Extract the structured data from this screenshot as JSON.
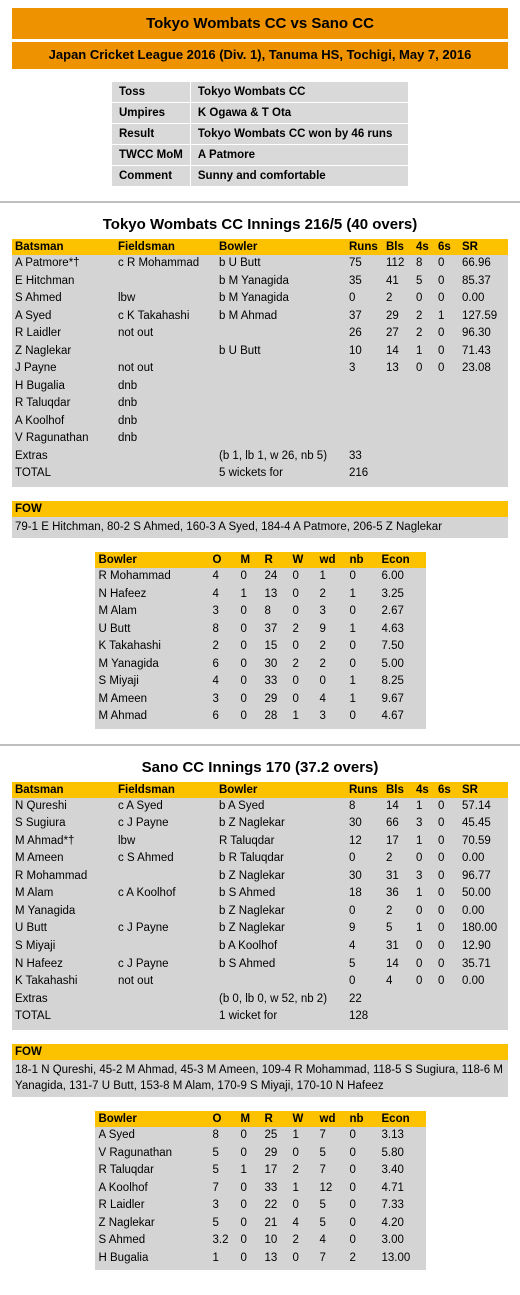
{
  "colors": {
    "title_orange": "#ee9200",
    "header_yellow": "#fcc200",
    "row_grey": "#d4d4d4",
    "info_grey": "#d9d9d9",
    "divider": "#bfbfbf"
  },
  "header": {
    "match_title": "Tokyo Wombats CC vs Sano CC",
    "match_subtitle": "Japan Cricket League 2016 (Div. 1), Tanuma HS, Tochigi, May 7, 2016"
  },
  "info": {
    "rows": [
      {
        "key": "Toss",
        "value": "Tokyo Wombats CC"
      },
      {
        "key": "Umpires",
        "value": "K Ogawa & T Ota"
      },
      {
        "key": "Result",
        "value": "Tokyo Wombats CC won by 46 runs"
      },
      {
        "key": "TWCC MoM",
        "value": "A Patmore"
      },
      {
        "key": "Comment",
        "value": "Sunny and comfortable"
      }
    ]
  },
  "batting_columns": [
    "Batsman",
    "Fieldsman",
    "Bowler",
    "Runs",
    "Bls",
    "4s",
    "6s",
    "SR"
  ],
  "bowling_columns": [
    "Bowler",
    "O",
    "M",
    "R",
    "W",
    "wd",
    "nb",
    "Econ"
  ],
  "fow_label": "FOW",
  "innings": [
    {
      "heading": "Tokyo Wombats CC Innings 216/5 (40 overs)",
      "batting": [
        {
          "batsman": "A Patmore*†",
          "fieldsman": "c R Mohammad",
          "bowler": "b U Butt",
          "runs": "75",
          "bls": "112",
          "fours": "8",
          "sixes": "0",
          "sr": "66.96"
        },
        {
          "batsman": "E Hitchman",
          "fieldsman": "",
          "bowler": "b M Yanagida",
          "runs": "35",
          "bls": "41",
          "fours": "5",
          "sixes": "0",
          "sr": "85.37"
        },
        {
          "batsman": "S Ahmed",
          "fieldsman": "lbw",
          "bowler": "b M Yanagida",
          "runs": "0",
          "bls": "2",
          "fours": "0",
          "sixes": "0",
          "sr": "0.00"
        },
        {
          "batsman": "A Syed",
          "fieldsman": "c K Takahashi",
          "bowler": "b M Ahmad",
          "runs": "37",
          "bls": "29",
          "fours": "2",
          "sixes": "1",
          "sr": "127.59"
        },
        {
          "batsman": "R Laidler",
          "fieldsman": "not out",
          "bowler": "",
          "runs": "26",
          "bls": "27",
          "fours": "2",
          "sixes": "0",
          "sr": "96.30"
        },
        {
          "batsman": "Z Naglekar",
          "fieldsman": "",
          "bowler": "b U Butt",
          "runs": "10",
          "bls": "14",
          "fours": "1",
          "sixes": "0",
          "sr": "71.43"
        },
        {
          "batsman": "J Payne",
          "fieldsman": "not out",
          "bowler": "",
          "runs": "3",
          "bls": "13",
          "fours": "0",
          "sixes": "0",
          "sr": "23.08"
        },
        {
          "batsman": "H Bugalia",
          "fieldsman": "dnb",
          "bowler": "",
          "runs": "",
          "bls": "",
          "fours": "",
          "sixes": "",
          "sr": ""
        },
        {
          "batsman": "R Taluqdar",
          "fieldsman": "dnb",
          "bowler": "",
          "runs": "",
          "bls": "",
          "fours": "",
          "sixes": "",
          "sr": ""
        },
        {
          "batsman": "A Koolhof",
          "fieldsman": "dnb",
          "bowler": "",
          "runs": "",
          "bls": "",
          "fours": "",
          "sixes": "",
          "sr": ""
        },
        {
          "batsman": "V Ragunathan",
          "fieldsman": "dnb",
          "bowler": "",
          "runs": "",
          "bls": "",
          "fours": "",
          "sixes": "",
          "sr": ""
        },
        {
          "batsman": "Extras",
          "fieldsman": "",
          "bowler": "(b 1, lb 1, w 26, nb 5)",
          "runs": "33",
          "bls": "",
          "fours": "",
          "sixes": "",
          "sr": ""
        },
        {
          "batsman": "TOTAL",
          "fieldsman": "",
          "bowler": "5 wickets for",
          "runs": "216",
          "bls": "",
          "fours": "",
          "sixes": "",
          "sr": ""
        }
      ],
      "fow": "79-1 E Hitchman, 80-2 S Ahmed, 160-3 A Syed, 184-4 A Patmore, 206-5 Z Naglekar",
      "bowling": [
        {
          "bowler": "R Mohammad",
          "o": "4",
          "m": "0",
          "r": "24",
          "w": "0",
          "wd": "1",
          "nb": "0",
          "econ": "6.00"
        },
        {
          "bowler": "N Hafeez",
          "o": "4",
          "m": "1",
          "r": "13",
          "w": "0",
          "wd": "2",
          "nb": "1",
          "econ": "3.25"
        },
        {
          "bowler": "M Alam",
          "o": "3",
          "m": "0",
          "r": "8",
          "w": "0",
          "wd": "3",
          "nb": "0",
          "econ": "2.67"
        },
        {
          "bowler": "U Butt",
          "o": "8",
          "m": "0",
          "r": "37",
          "w": "2",
          "wd": "9",
          "nb": "1",
          "econ": "4.63"
        },
        {
          "bowler": "K Takahashi",
          "o": "2",
          "m": "0",
          "r": "15",
          "w": "0",
          "wd": "2",
          "nb": "0",
          "econ": "7.50"
        },
        {
          "bowler": "M Yanagida",
          "o": "6",
          "m": "0",
          "r": "30",
          "w": "2",
          "wd": "2",
          "nb": "0",
          "econ": "5.00"
        },
        {
          "bowler": "S Miyaji",
          "o": "4",
          "m": "0",
          "r": "33",
          "w": "0",
          "wd": "0",
          "nb": "1",
          "econ": "8.25"
        },
        {
          "bowler": "M Ameen",
          "o": "3",
          "m": "0",
          "r": "29",
          "w": "0",
          "wd": "4",
          "nb": "1",
          "econ": "9.67"
        },
        {
          "bowler": "M Ahmad",
          "o": "6",
          "m": "0",
          "r": "28",
          "w": "1",
          "wd": "3",
          "nb": "0",
          "econ": "4.67"
        }
      ]
    },
    {
      "heading": "Sano CC Innings 170 (37.2 overs)",
      "batting": [
        {
          "batsman": "N Qureshi",
          "fieldsman": "c A Syed",
          "bowler": "b A Syed",
          "runs": "8",
          "bls": "14",
          "fours": "1",
          "sixes": "0",
          "sr": "57.14"
        },
        {
          "batsman": "S Sugiura",
          "fieldsman": "c J Payne",
          "bowler": "b Z Naglekar",
          "runs": "30",
          "bls": "66",
          "fours": "3",
          "sixes": "0",
          "sr": "45.45"
        },
        {
          "batsman": "M Ahmad*†",
          "fieldsman": "lbw",
          "bowler": "R Taluqdar",
          "runs": "12",
          "bls": "17",
          "fours": "1",
          "sixes": "0",
          "sr": "70.59"
        },
        {
          "batsman": "M Ameen",
          "fieldsman": "c S Ahmed",
          "bowler": "b R Taluqdar",
          "runs": "0",
          "bls": "2",
          "fours": "0",
          "sixes": "0",
          "sr": "0.00"
        },
        {
          "batsman": "R Mohammad",
          "fieldsman": "",
          "bowler": "b  Z Naglekar",
          "runs": "30",
          "bls": "31",
          "fours": "3",
          "sixes": "0",
          "sr": "96.77"
        },
        {
          "batsman": "M Alam",
          "fieldsman": "c A Koolhof",
          "bowler": "b S Ahmed",
          "runs": "18",
          "bls": "36",
          "fours": "1",
          "sixes": "0",
          "sr": "50.00"
        },
        {
          "batsman": "M Yanagida",
          "fieldsman": "",
          "bowler": "b Z Naglekar",
          "runs": "0",
          "bls": "2",
          "fours": "0",
          "sixes": "0",
          "sr": "0.00"
        },
        {
          "batsman": "U Butt",
          "fieldsman": "c J Payne",
          "bowler": "b Z Naglekar",
          "runs": "9",
          "bls": "5",
          "fours": "1",
          "sixes": "0",
          "sr": "180.00"
        },
        {
          "batsman": "S Miyaji",
          "fieldsman": "",
          "bowler": "b A Koolhof",
          "runs": "4",
          "bls": "31",
          "fours": "0",
          "sixes": "0",
          "sr": "12.90"
        },
        {
          "batsman": "N Hafeez",
          "fieldsman": "c J Payne",
          "bowler": "b S Ahmed",
          "runs": "5",
          "bls": "14",
          "fours": "0",
          "sixes": "0",
          "sr": "35.71"
        },
        {
          "batsman": "K Takahashi",
          "fieldsman": "not out",
          "bowler": "",
          "runs": "0",
          "bls": "4",
          "fours": "0",
          "sixes": "0",
          "sr": "0.00"
        },
        {
          "batsman": "Extras",
          "fieldsman": "",
          "bowler": "(b 0, lb 0, w 52, nb 2)",
          "runs": "22",
          "bls": "",
          "fours": "",
          "sixes": "",
          "sr": ""
        },
        {
          "batsman": "TOTAL",
          "fieldsman": "",
          "bowler": "1 wicket for",
          "runs": "128",
          "bls": "",
          "fours": "",
          "sixes": "",
          "sr": ""
        }
      ],
      "fow": "18-1 N Qureshi, 45-2 M Ahmad, 45-3 M Ameen, 109-4 R Mohammad, 118-5 S Sugiura, 118-6 M Yanagida, 131-7 U Butt, 153-8 M Alam, 170-9 S Miyaji, 170-10 N Hafeez",
      "bowling": [
        {
          "bowler": "A Syed",
          "o": "8",
          "m": "0",
          "r": "25",
          "w": "1",
          "wd": "7",
          "nb": "0",
          "econ": "3.13"
        },
        {
          "bowler": "V Ragunathan",
          "o": "5",
          "m": "0",
          "r": "29",
          "w": "0",
          "wd": "5",
          "nb": "0",
          "econ": "5.80"
        },
        {
          "bowler": "R Taluqdar",
          "o": "5",
          "m": "1",
          "r": "17",
          "w": "2",
          "wd": "7",
          "nb": "0",
          "econ": "3.40"
        },
        {
          "bowler": "A Koolhof",
          "o": "7",
          "m": "0",
          "r": "33",
          "w": "1",
          "wd": "12",
          "nb": "0",
          "econ": "4.71"
        },
        {
          "bowler": "R Laidler",
          "o": "3",
          "m": "0",
          "r": "22",
          "w": "0",
          "wd": "5",
          "nb": "0",
          "econ": "7.33"
        },
        {
          "bowler": "Z Naglekar",
          "o": "5",
          "m": "0",
          "r": "21",
          "w": "4",
          "wd": "5",
          "nb": "0",
          "econ": "4.20"
        },
        {
          "bowler": "S Ahmed",
          "o": "3.2",
          "m": "0",
          "r": "10",
          "w": "2",
          "wd": "4",
          "nb": "0",
          "econ": "3.00"
        },
        {
          "bowler": "H Bugalia",
          "o": "1",
          "m": "0",
          "r": "13",
          "w": "0",
          "wd": "7",
          "nb": "2",
          "econ": "13.00"
        }
      ]
    }
  ]
}
